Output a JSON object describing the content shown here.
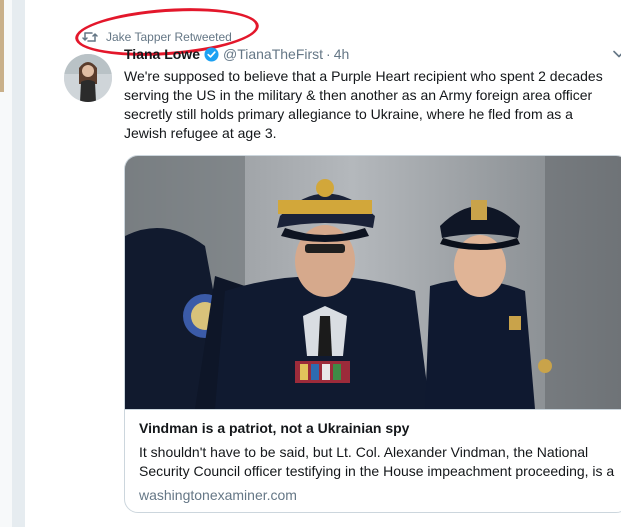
{
  "retweet": {
    "label": "Jake Tapper Retweeted"
  },
  "tweet": {
    "display_name": "Tiana Lowe",
    "handle": "@TianaTheFirst",
    "separator": "·",
    "time": "4h",
    "text": "We're supposed to believe that a Purple Heart recipient who spent 2 decades serving the US in the military & then another as an Army foreign area officer secretly still holds primary allegiance to Ukraine, where he fled from as a Jewish refugee at age 3."
  },
  "link_card": {
    "title": "Vindman is a patriot, not a Ukrainian spy",
    "description": "It shouldn't have to be said, but Lt. Col. Alexander Vindman, the National Security Council officer testifying in the House impeachment proceeding, is a",
    "domain": "washingtonexaminer.com"
  },
  "colors": {
    "annotation_oval": "#e3172b",
    "verified_badge": "#1da1f2",
    "secondary_text": "#657786"
  },
  "icons": [
    "retweet-icon",
    "verified-badge-icon",
    "chevron-down-icon"
  ]
}
